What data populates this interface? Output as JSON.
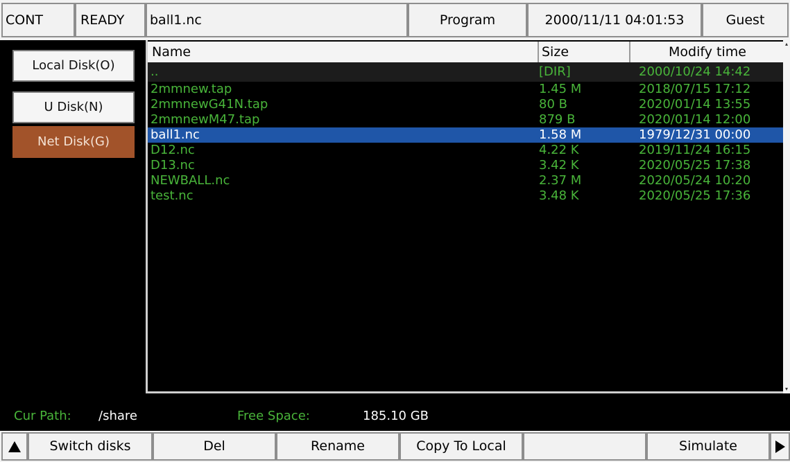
{
  "status_bar": {
    "mode": "CONT",
    "state": "READY",
    "current_file": "ball1.nc",
    "screen": "Program",
    "datetime": "2000/11/11 04:01:53",
    "user": "Guest"
  },
  "disks": [
    {
      "label": "Local Disk(O)",
      "active": false
    },
    {
      "label": "U Disk(N)",
      "active": false
    },
    {
      "label": "Net Disk(G)",
      "active": true
    }
  ],
  "file_list": {
    "columns": {
      "name": "Name",
      "size": "Size",
      "time": "Modify time"
    },
    "rows": [
      {
        "name": "..",
        "size": "[DIR]",
        "time": "2000/10/24 14:42",
        "kind": "dir",
        "selected": false
      },
      {
        "name": "2mmnew.tap",
        "size": "1.45 M",
        "time": "2018/07/15 17:12",
        "kind": "file",
        "selected": false
      },
      {
        "name": "2mmnewG41N.tap",
        "size": "80 B",
        "time": "2020/01/14 13:55",
        "kind": "file",
        "selected": false
      },
      {
        "name": "2mmnewM47.tap",
        "size": "879 B",
        "time": "2020/01/14 12:00",
        "kind": "file",
        "selected": false
      },
      {
        "name": "ball1.nc",
        "size": "1.58 M",
        "time": "1979/12/31 00:00",
        "kind": "file",
        "selected": true
      },
      {
        "name": "D12.nc",
        "size": "4.22 K",
        "time": "2019/11/24 16:15",
        "kind": "file",
        "selected": false
      },
      {
        "name": "D13.nc",
        "size": "3.42 K",
        "time": "2020/05/25 17:38",
        "kind": "file",
        "selected": false
      },
      {
        "name": "NEWBALL.nc",
        "size": "2.37 M",
        "time": "2020/05/24 10:20",
        "kind": "file",
        "selected": false
      },
      {
        "name": "test.nc",
        "size": "3.48 K",
        "time": "2020/05/25 17:36",
        "kind": "file",
        "selected": false
      }
    ]
  },
  "path_bar": {
    "cur_path_label": "Cur Path:",
    "cur_path": "/share",
    "free_space_label": "Free Space:",
    "free_space": "185.10 GB"
  },
  "softkeys": [
    "Switch disks",
    "Del",
    "Rename",
    "Copy To Local",
    "",
    "Simulate"
  ],
  "colors": {
    "file_text": "#49b53a",
    "selected_row": "#1f56a8",
    "active_disk": "#a2532a",
    "background": "#000000"
  }
}
